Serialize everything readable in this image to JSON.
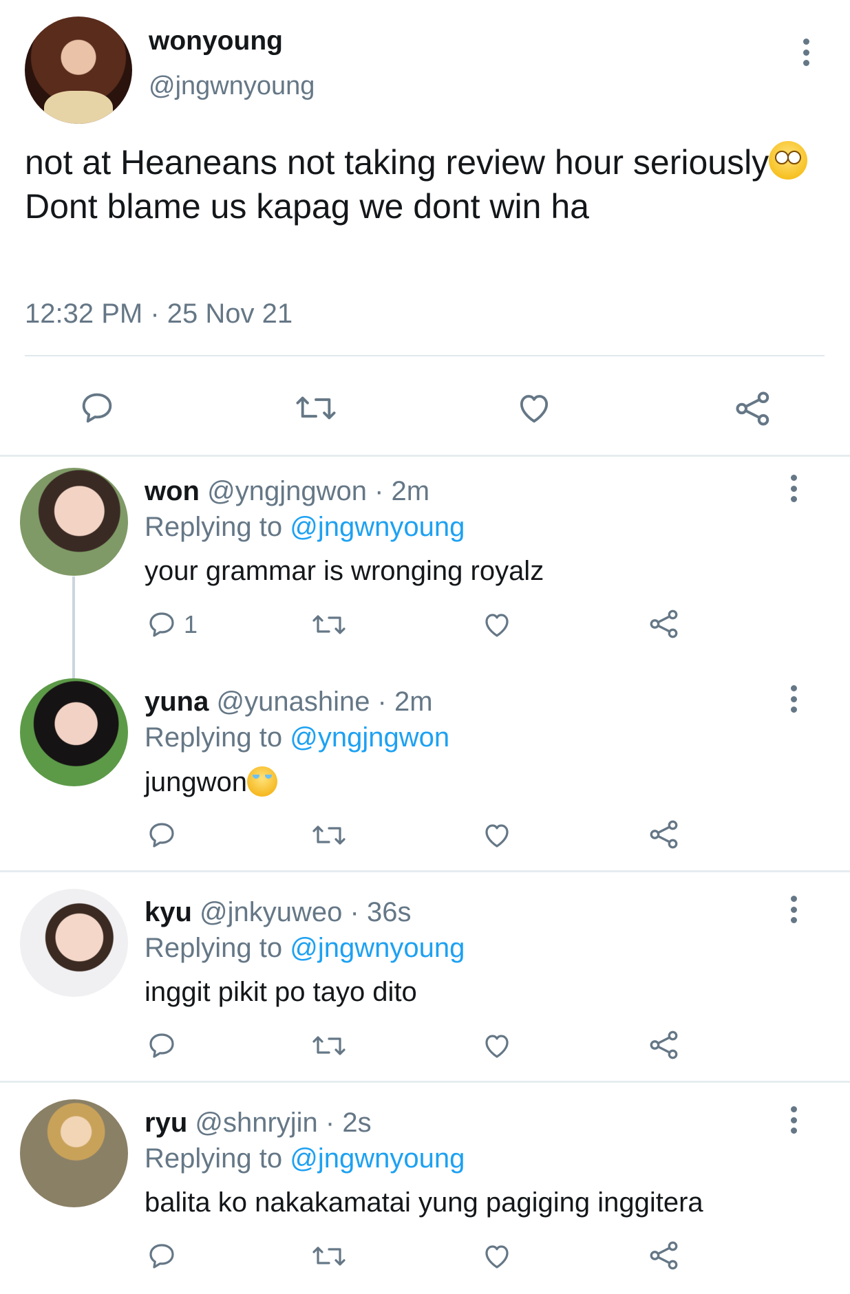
{
  "tweet": {
    "display_name": "wonyoung",
    "handle": "@jngwnyoung",
    "text_before_emoji": "not at Heaneans not taking review hour seriously",
    "text_after_emoji": " Dont blame us kapag we dont win ha",
    "emoji": "face-with-rolling-eyes",
    "timestamp": "12:32 PM · 25 Nov 21"
  },
  "replies": [
    {
      "name": "won",
      "sub": " @yngjngwon · 2m",
      "replying_prefix": "Replying to ",
      "replying_to": "@jngwnyoung",
      "text": "your grammar is wronging royalz",
      "reply_count": "1"
    },
    {
      "name": "yuna",
      "sub": " @yunashine · 2m",
      "replying_prefix": "Replying to ",
      "replying_to": "@yngjngwon",
      "text": "jungwon",
      "emoji": "loudly-crying-face",
      "reply_count": ""
    },
    {
      "name": "kyu",
      "sub": " @jnkyuweo · 36s",
      "replying_prefix": "Replying to ",
      "replying_to": "@jngwnyoung",
      "text": "inggit pikit po tayo dito",
      "reply_count": ""
    },
    {
      "name": "ryu",
      "sub": " @shnryjin · 2s",
      "replying_prefix": "Replying to ",
      "replying_to": "@jngwnyoung",
      "text": "balita ko nakakamatai yung pagiging inggitera",
      "reply_count": ""
    }
  ],
  "colors": {
    "text": "#14171a",
    "secondary": "#657786",
    "link": "#1da1f2",
    "divider": "#e6ecf0"
  },
  "icons": [
    "reply-icon",
    "retweet-icon",
    "like-icon",
    "share-icon",
    "more-icon"
  ]
}
